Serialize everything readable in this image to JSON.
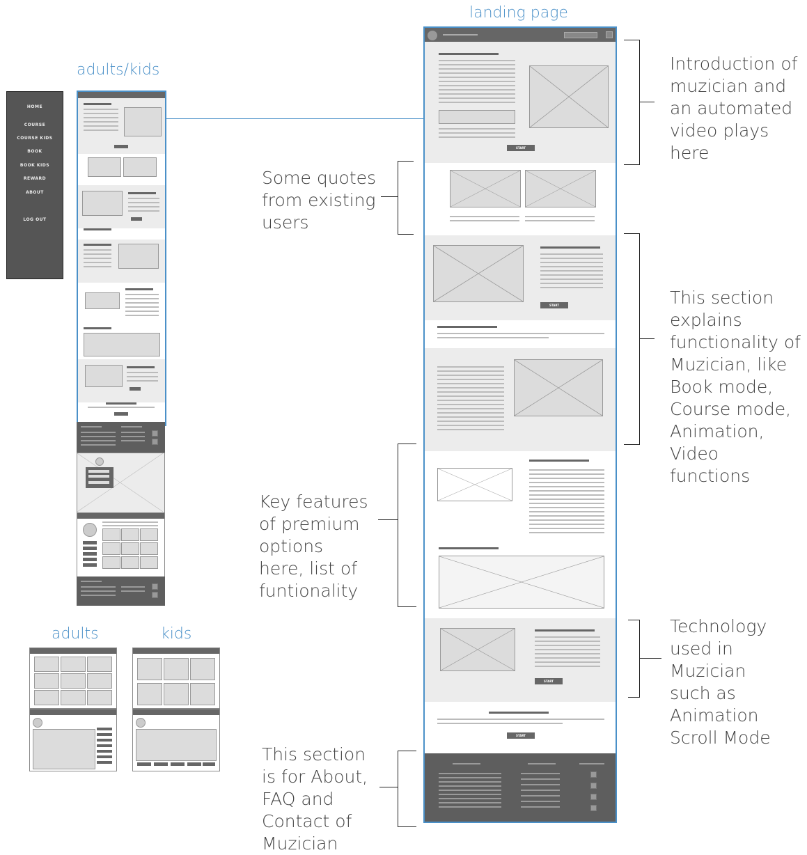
{
  "titles": {
    "landing": "landing page",
    "adults_kids": "adults/kids",
    "adults": "adults",
    "kids": "kids"
  },
  "menu": {
    "items": [
      "HOME",
      "COURSE",
      "COURSE KIDS",
      "BOOK",
      "BOOK KIDS",
      "REWARD",
      "ABOUT",
      "LOG OUT"
    ]
  },
  "annotations": {
    "intro": [
      "Introduction of",
      "muzician and",
      "an automated",
      "video plays",
      "here"
    ],
    "quotes": [
      "Some quotes",
      "from existing",
      "users"
    ],
    "functionality": [
      "This section",
      "explains",
      "functionality of",
      "Muzician, like",
      "Book mode,",
      "Course mode,",
      "Animation, Video",
      "functions"
    ],
    "premium": [
      "Key features",
      "of premium",
      "options",
      "here, list of",
      "funtionality"
    ],
    "technology": [
      "Technology",
      "used in",
      "Muzician",
      "such as",
      "Animation",
      "Scroll Mode"
    ],
    "about": [
      "This section",
      "is for About,",
      "FAQ and",
      "Contact of",
      "Muzician"
    ]
  },
  "buttons": {
    "start": "START"
  },
  "colors": {
    "accent": "#4a90c8",
    "dark": "#5e5e5e",
    "light": "#ececec"
  }
}
